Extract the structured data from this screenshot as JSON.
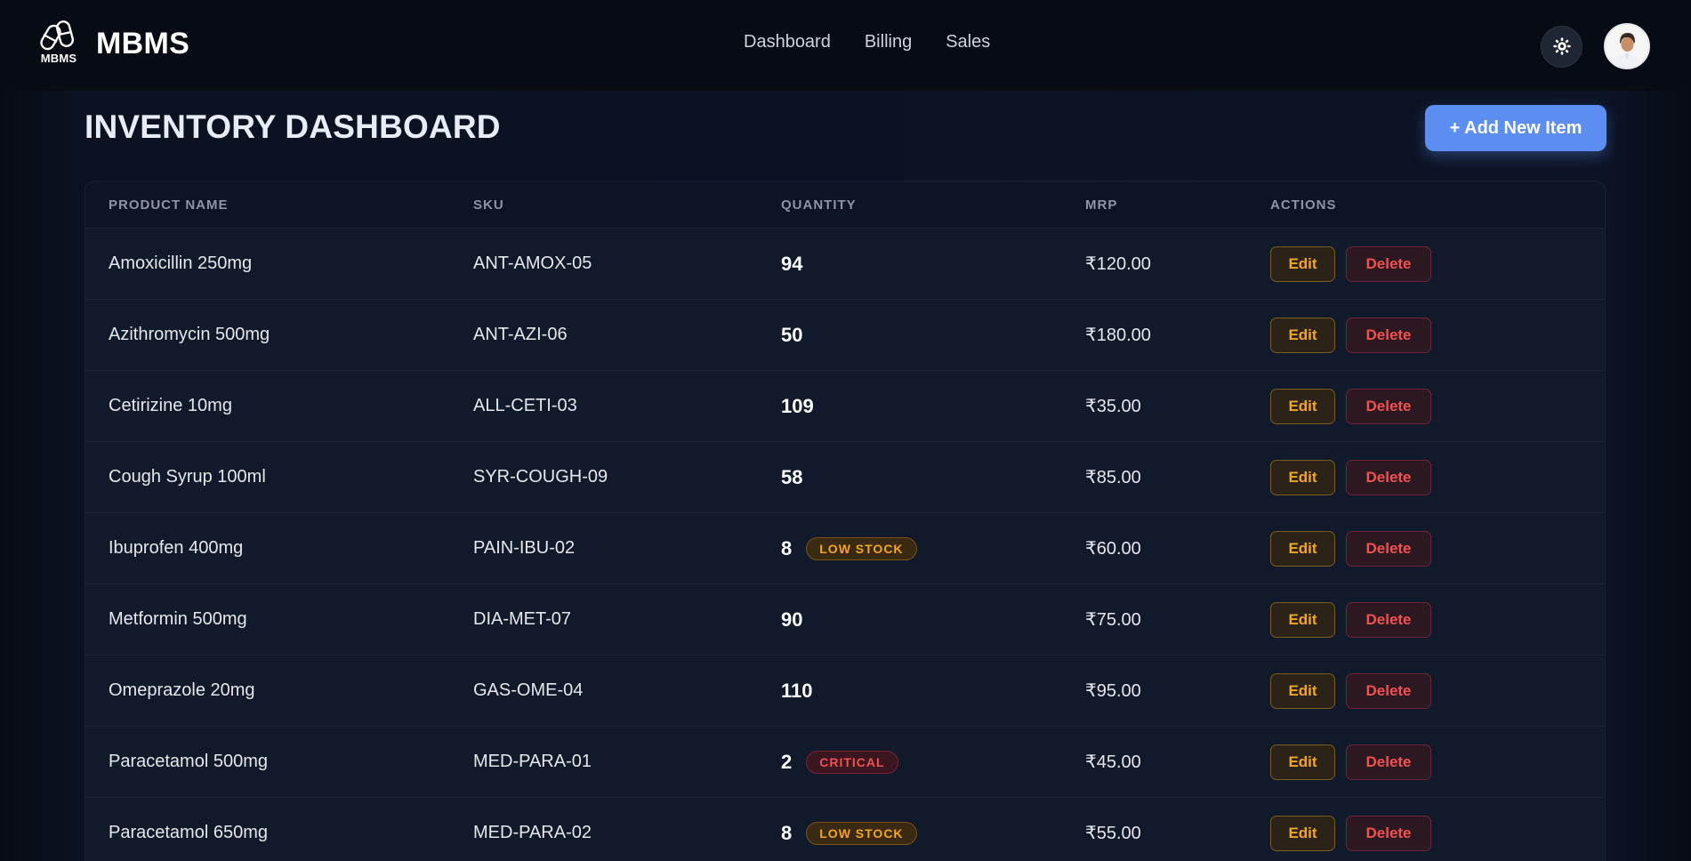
{
  "navbar": {
    "logo_text": "MBMS",
    "brand_name": "MBMS",
    "links": [
      "Dashboard",
      "Billing",
      "Sales"
    ],
    "theme_icon": "gear-icon",
    "avatar_icon": "user-avatar"
  },
  "header": {
    "title": "INVENTORY DASHBOARD",
    "add_button_label": "+ Add New Item",
    "accent_color": "#5b8ef0"
  },
  "table": {
    "columns": [
      "PRODUCT NAME",
      "SKU",
      "QUANTITY",
      "MRP",
      "ACTIONS"
    ],
    "edit_label": "Edit",
    "delete_label": "Delete",
    "rows": [
      {
        "name": "Amoxicillin 250mg",
        "sku": "ANT-AMOX-05",
        "qty": "94",
        "badge": "",
        "badge_type": "",
        "mrp": "₹120.00"
      },
      {
        "name": "Azithromycin 500mg",
        "sku": "ANT-AZI-06",
        "qty": "50",
        "badge": "",
        "badge_type": "",
        "mrp": "₹180.00"
      },
      {
        "name": "Cetirizine 10mg",
        "sku": "ALL-CETI-03",
        "qty": "109",
        "badge": "",
        "badge_type": "",
        "mrp": "₹35.00"
      },
      {
        "name": "Cough Syrup 100ml",
        "sku": "SYR-COUGH-09",
        "qty": "58",
        "badge": "",
        "badge_type": "",
        "mrp": "₹85.00"
      },
      {
        "name": "Ibuprofen 400mg",
        "sku": "PAIN-IBU-02",
        "qty": "8",
        "badge": "LOW STOCK",
        "badge_type": "low",
        "mrp": "₹60.00"
      },
      {
        "name": "Metformin 500mg",
        "sku": "DIA-MET-07",
        "qty": "90",
        "badge": "",
        "badge_type": "",
        "mrp": "₹75.00"
      },
      {
        "name": "Omeprazole 20mg",
        "sku": "GAS-OME-04",
        "qty": "110",
        "badge": "",
        "badge_type": "",
        "mrp": "₹95.00"
      },
      {
        "name": "Paracetamol 500mg",
        "sku": "MED-PARA-01",
        "qty": "2",
        "badge": "CRITICAL",
        "badge_type": "critical",
        "mrp": "₹45.00"
      },
      {
        "name": "Paracetamol 650mg",
        "sku": "MED-PARA-02",
        "qty": "8",
        "badge": "LOW STOCK",
        "badge_type": "low",
        "mrp": "₹55.00"
      }
    ]
  },
  "colors": {
    "low_stock": "#f5a524",
    "critical": "#f05252",
    "background": "#0b1220"
  }
}
